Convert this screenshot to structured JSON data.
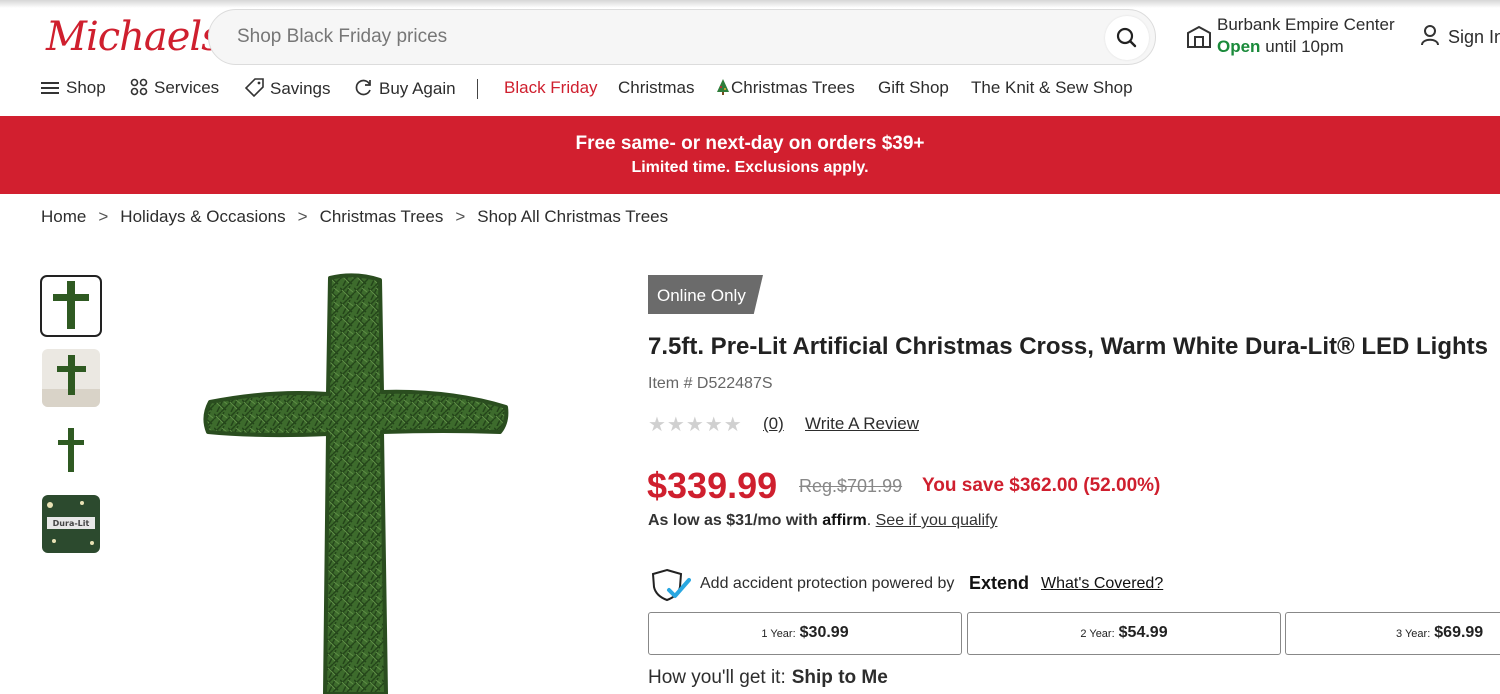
{
  "header": {
    "logo": "Michaels",
    "search_placeholder": "Shop Black Friday prices",
    "store_name": "Burbank Empire Center",
    "store_open": "Open",
    "store_hours": "until 10pm",
    "sign_in": "Sign In",
    "accent_color": "#cf1f2e"
  },
  "nav": {
    "items": [
      "Shop",
      "Services",
      "Savings",
      "Buy Again",
      "Black Friday",
      "Christmas",
      "Christmas Trees",
      "Gift Shop",
      "The Knit & Sew Shop"
    ]
  },
  "promo": {
    "line1": "Free same- or next-day on orders $39+",
    "line2": "Limited time. Exclusions apply."
  },
  "breadcrumb": [
    "Home",
    "Holidays & Occasions",
    "Christmas Trees",
    "Shop All Christmas Trees"
  ],
  "breadcrumb_sep": ">",
  "product": {
    "badge": "Online Only",
    "title": "7.5ft. Pre-Lit Artificial Christmas Cross, Warm White Dura-Lit® LED Lights",
    "item_number": "Item # D522487S",
    "rating_stars": "★★★★★",
    "rating_value": 0,
    "review_count": "(0)",
    "write_review": "Write A Review",
    "price": "$339.99",
    "reg_price": "Reg.$701.99",
    "savings": "You save $362.00 (52.00%)",
    "affirm_prefix": "As low as $31/mo with",
    "affirm_brand": "affirm",
    "affirm_link": "See if you qualify",
    "protection_text": "Add accident protection powered by",
    "protection_brand": "Extend",
    "protection_link": "What's Covered?",
    "plans": [
      {
        "label": "1 Year:",
        "price": "$30.99"
      },
      {
        "label": "2 Year:",
        "price": "$54.99"
      },
      {
        "label": "3 Year:",
        "price": "$69.99"
      }
    ],
    "delivery_label": "How you'll get it:",
    "delivery_value": "Ship to Me",
    "thumb_tag": "Dura-Lit"
  }
}
